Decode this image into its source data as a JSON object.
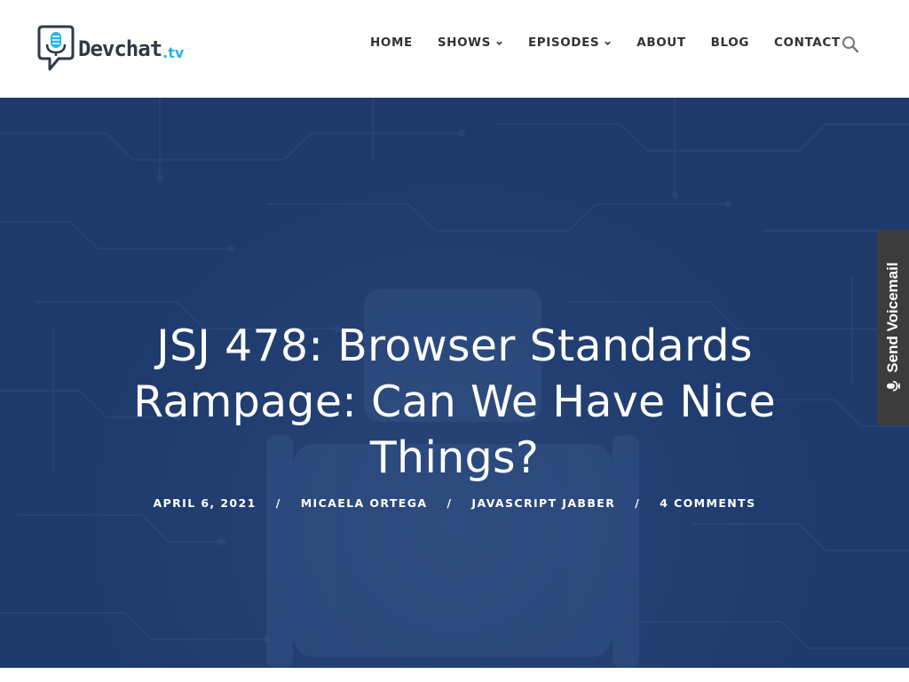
{
  "brand": {
    "name": "Devchat",
    "tld": ".tv",
    "accent_color": "#25b5e4",
    "text_color": "#2f3a45"
  },
  "nav": {
    "items": [
      {
        "label": "HOME",
        "has_dropdown": false
      },
      {
        "label": "SHOWS",
        "has_dropdown": true
      },
      {
        "label": "EPISODES",
        "has_dropdown": true
      },
      {
        "label": "ABOUT",
        "has_dropdown": false
      },
      {
        "label": "BLOG",
        "has_dropdown": false
      },
      {
        "label": "CONTACT",
        "has_dropdown": false
      }
    ],
    "search_icon": "search-icon"
  },
  "hero": {
    "background_color": "#1e3a6c",
    "title": "JSJ 478: Browser Standards Rampage: Can We Have Nice Things?",
    "meta": {
      "date": "APRIL 6, 2021",
      "author": "MICAELA ORTEGA",
      "category": "JAVASCRIPT JABBER",
      "comments": "4 COMMENTS",
      "separator": "/"
    }
  },
  "voicemail": {
    "label": "Send Voicemail",
    "icon": "microphone-icon",
    "background_color": "#3c3c3c"
  }
}
